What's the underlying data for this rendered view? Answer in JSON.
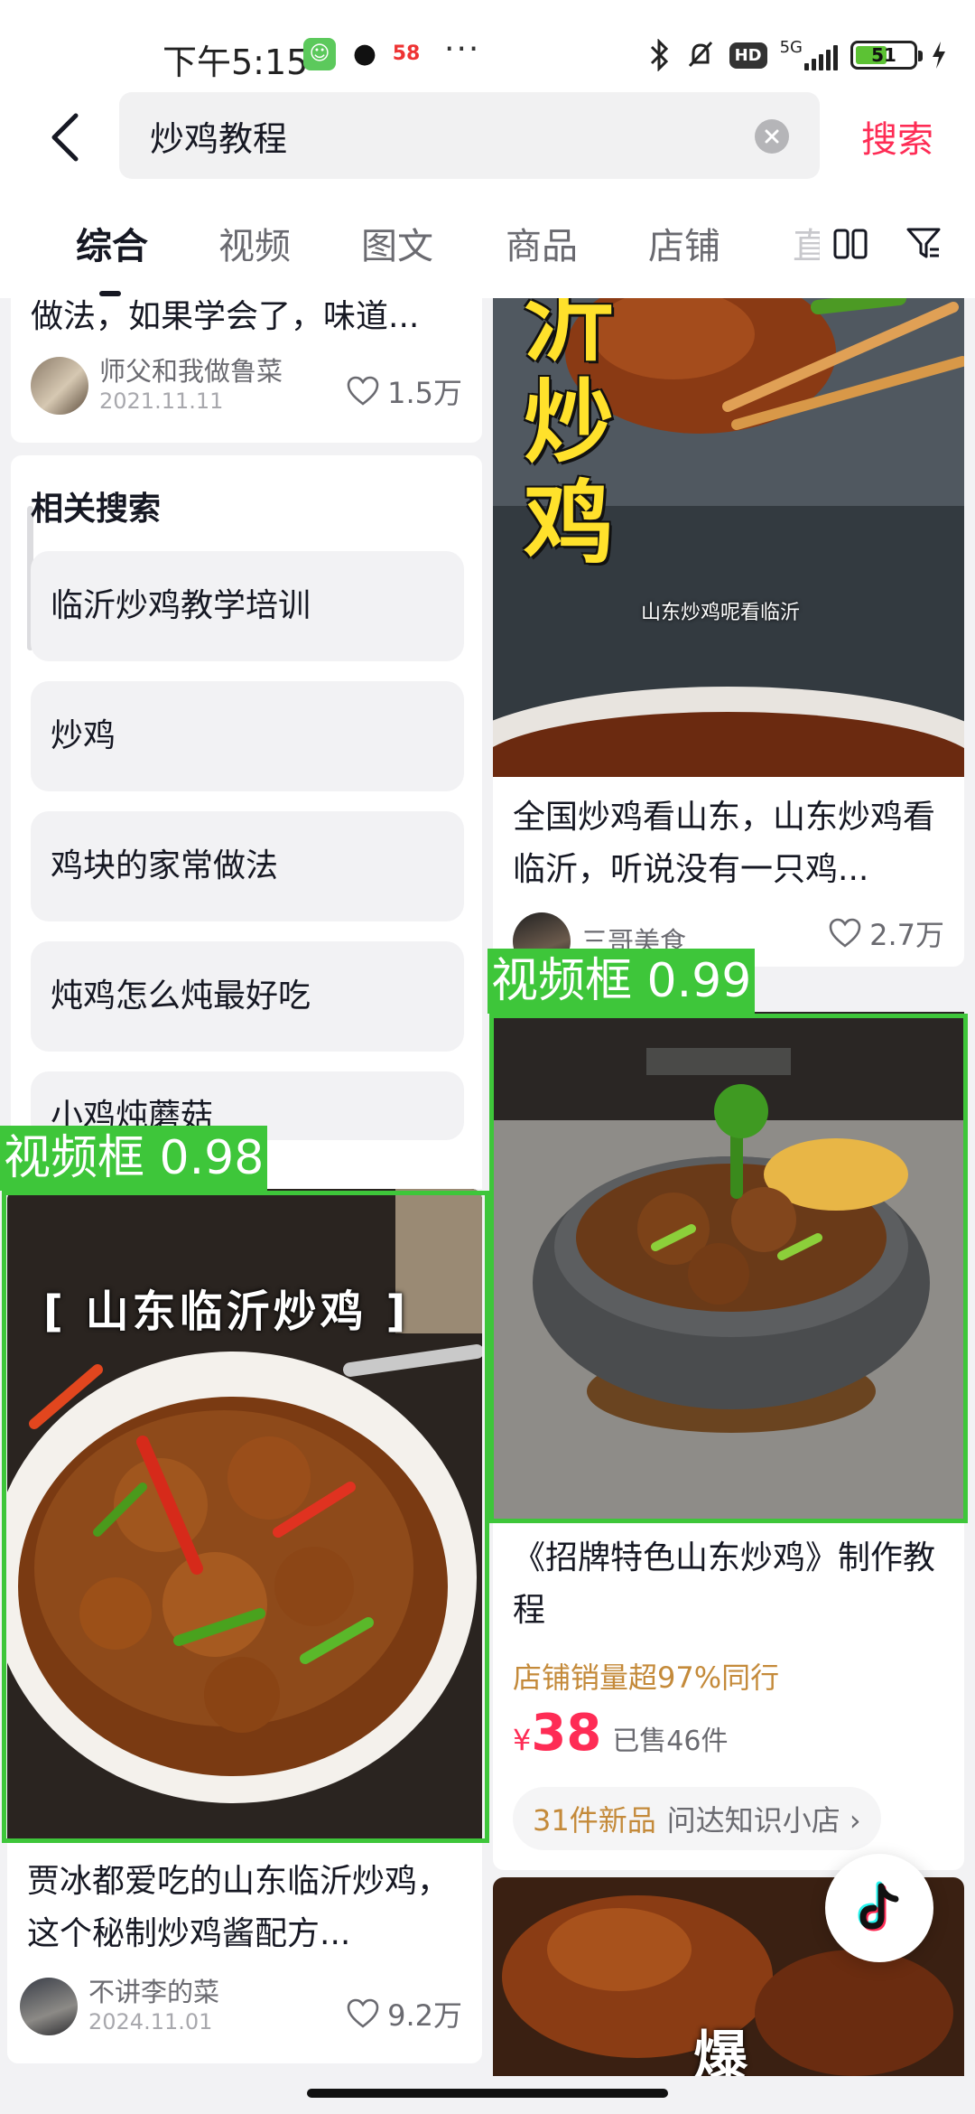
{
  "status_bar": {
    "time": "下午5:15",
    "app_icon_58": "58",
    "more_dots": "···",
    "hd": "HD",
    "network": "5G",
    "battery": "51"
  },
  "search": {
    "query": "炒鸡教程",
    "placeholder": "",
    "submit_label": "搜索"
  },
  "tabs": [
    {
      "label": "综合",
      "active": true
    },
    {
      "label": "视频"
    },
    {
      "label": "图文"
    },
    {
      "label": "商品"
    },
    {
      "label": "店铺"
    },
    {
      "label": "直"
    }
  ],
  "left_column": {
    "top_card": {
      "title_tail": "做法，如果学会了，味道...",
      "author": "师父和我做鲁菜",
      "date": "2021.11.11",
      "likes": "1.5万"
    },
    "related": {
      "title": "相关搜索",
      "items": [
        "临沂炒鸡教学培训",
        "炒鸡",
        "鸡块的家常做法",
        "炖鸡怎么炖最好吃",
        "小鸡炖蘑菇"
      ]
    },
    "video_card": {
      "image_caption": "[ 山东临沂炒鸡 ]",
      "title": "贾冰都爱吃的山东临沂炒鸡，这个秘制炒鸡酱配方...",
      "author": "不讲李的菜",
      "date": "2024.11.01",
      "likes": "9.2万"
    }
  },
  "right_column": {
    "top_card": {
      "image_big_text": "沂炒鸡",
      "image_sub_text": "山东炒鸡呢看临沂",
      "title": "全国炒鸡看山东，山东炒鸡看临沂，听说没有一只鸡...",
      "author": "三哥美食",
      "likes": "2.7万"
    },
    "product_card": {
      "title": "《招牌特色山东炒鸡》制作教程",
      "shop_tag": "店铺销量超97%同行",
      "price_symbol": "¥",
      "price": "38",
      "sold": "已售46件",
      "new_items": "31件新品",
      "shop_name": "问达知识小店 ›"
    },
    "bottom_card": {
      "image_text": "爆"
    }
  },
  "detections": [
    {
      "label": "视频框 0.98"
    },
    {
      "label": "视频框 0.99"
    }
  ],
  "colors": {
    "accent": "#fe2c55",
    "detection": "#3ec63a",
    "shop_tag": "#c48a3a"
  }
}
